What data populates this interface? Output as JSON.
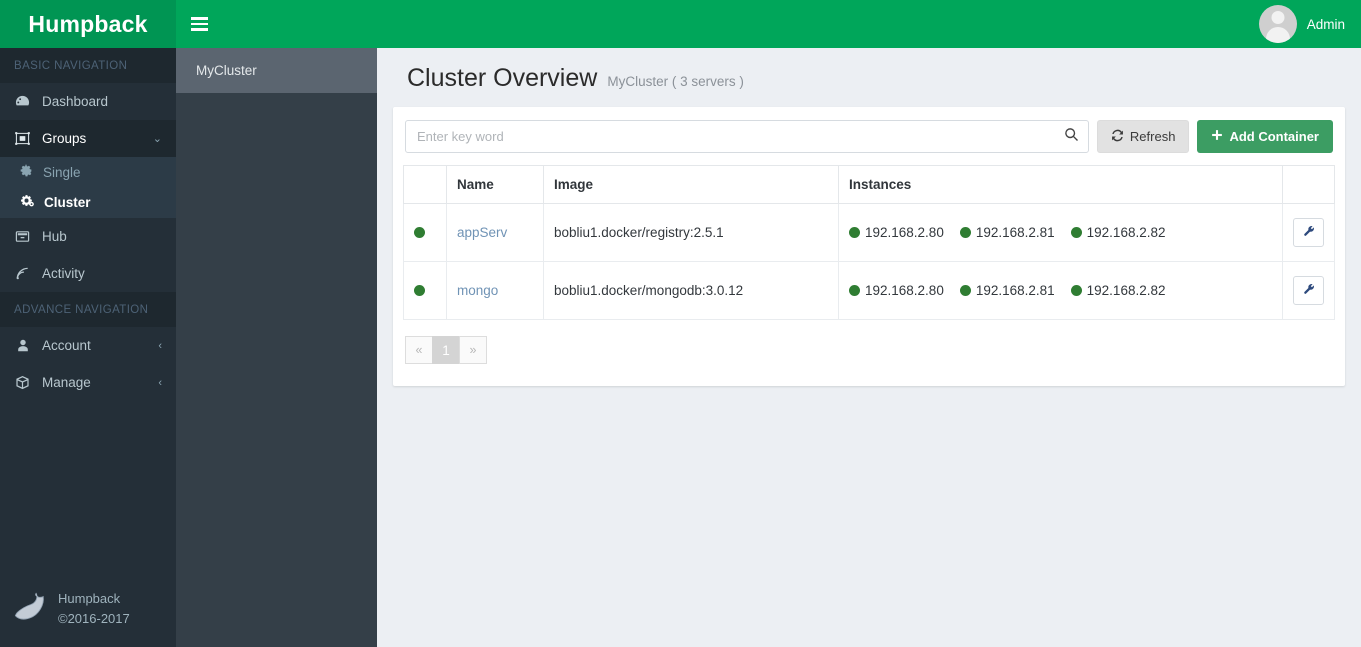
{
  "app": {
    "brand": "Humpback",
    "user": "Admin"
  },
  "sidebar": {
    "section_basic": "BASIC NAVIGATION",
    "section_advance": "ADVANCE NAVIGATION",
    "items": [
      {
        "label": "Dashboard",
        "icon": "dashboard-icon"
      },
      {
        "label": "Groups",
        "icon": "groups-icon",
        "caret": "⌄"
      },
      {
        "label": "Hub",
        "icon": "hub-icon"
      },
      {
        "label": "Activity",
        "icon": "activity-icon"
      }
    ],
    "subitems": [
      {
        "label": "Single",
        "icon": "gear-icon"
      },
      {
        "label": "Cluster",
        "icon": "gears-icon"
      }
    ],
    "advance_items": [
      {
        "label": "Account",
        "icon": "user-icon",
        "caret": "‹"
      },
      {
        "label": "Manage",
        "icon": "box-icon",
        "caret": "‹"
      }
    ],
    "footer": {
      "name": "Humpback",
      "copyright": "©2016-2017"
    }
  },
  "grouppanel": {
    "items": [
      {
        "label": "MyCluster",
        "active": true
      }
    ]
  },
  "page": {
    "title": "Cluster Overview",
    "subtitle": "MyCluster ( 3 servers )"
  },
  "toolbar": {
    "search_placeholder": "Enter key word",
    "search_value": "",
    "refresh_label": "Refresh",
    "add_label": "Add Container"
  },
  "table": {
    "columns": [
      "",
      "Name",
      "Image",
      "Instances",
      ""
    ],
    "rows": [
      {
        "status": "running",
        "name": "appServ",
        "image": "bobliu1.docker/registry:2.5.1",
        "instances": [
          "192.168.2.80",
          "192.168.2.81",
          "192.168.2.82"
        ]
      },
      {
        "status": "running",
        "name": "mongo",
        "image": "bobliu1.docker/mongodb:3.0.12",
        "instances": [
          "192.168.2.80",
          "192.168.2.81",
          "192.168.2.82"
        ]
      }
    ]
  },
  "pagination": {
    "prev": "«",
    "pages": [
      "1"
    ],
    "next": "»",
    "current": "1"
  },
  "colors": {
    "brand_green": "#00a65a",
    "brand_green_dark": "#009553",
    "sidebar_bg": "#242f38",
    "group_panel_bg": "#343f48",
    "group_active_bg": "#5b6570",
    "content_bg": "#eceff3",
    "status_dot": "#2f7d32",
    "link": "#7093b5",
    "add_button": "#3c9d63",
    "refresh_button": "#e2e2e2"
  }
}
